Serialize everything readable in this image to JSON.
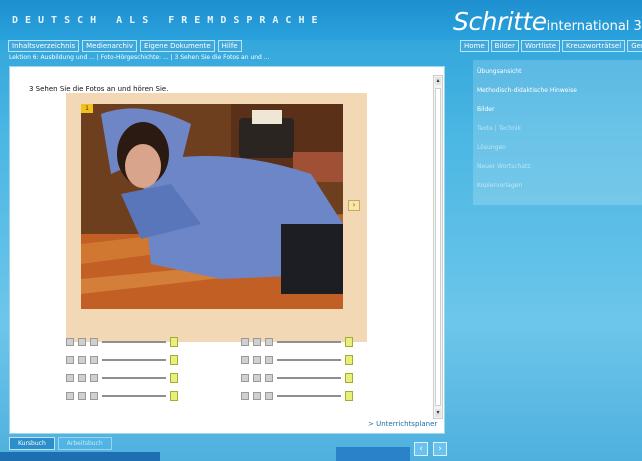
{
  "header": {
    "brand_left": "DEUTSCH ALS FREMDSPRACHE",
    "brand_right_main": "Schritte",
    "brand_right_sub": "international 3"
  },
  "tabs_left": [
    "Inhaltsverzeichnis",
    "Medienarchiv",
    "Eigene Dokumente",
    "Hilfe"
  ],
  "tabs_right": [
    "Home",
    "Bilder",
    "Wortliste",
    "Kreuzworträtsel",
    "Genera"
  ],
  "breadcrumb": "Lektion 6: Ausbildung und ... | Foto-Hörgeschichte: ... | 3 Sehen Sie die Fotos an und ...",
  "main": {
    "instruction": "3 Sehen Sie die Fotos an und hören Sie.",
    "photo_badge": "1",
    "photo_next_icon": "chevron-right-icon",
    "link_unterrichtsplaner": "> Unterrichtsplaner"
  },
  "side_panel": {
    "items": [
      {
        "label": "Übungsansicht",
        "state": "active"
      },
      {
        "label": "Methodisch-didaktische Hinweise",
        "state": "active"
      },
      {
        "label": "Bilder",
        "state": "active"
      },
      {
        "label": "Texte | Technik",
        "state": "dim"
      },
      {
        "label": "Lösungen",
        "state": "dim"
      },
      {
        "label": "Neuer Wortschatz",
        "state": "dim"
      },
      {
        "label": "Kopiervorlagen",
        "state": "dim"
      }
    ]
  },
  "bottom_tabs": [
    "Kursbuch",
    "Arbeitsbuch"
  ],
  "nav": {
    "prev": "‹",
    "next": "›"
  },
  "colors": {
    "sky": "#2aa0d9",
    "panel_white": "#ffffff",
    "photo_frame": "#f3d8b6",
    "accent_yellow": "#f2c21b"
  }
}
